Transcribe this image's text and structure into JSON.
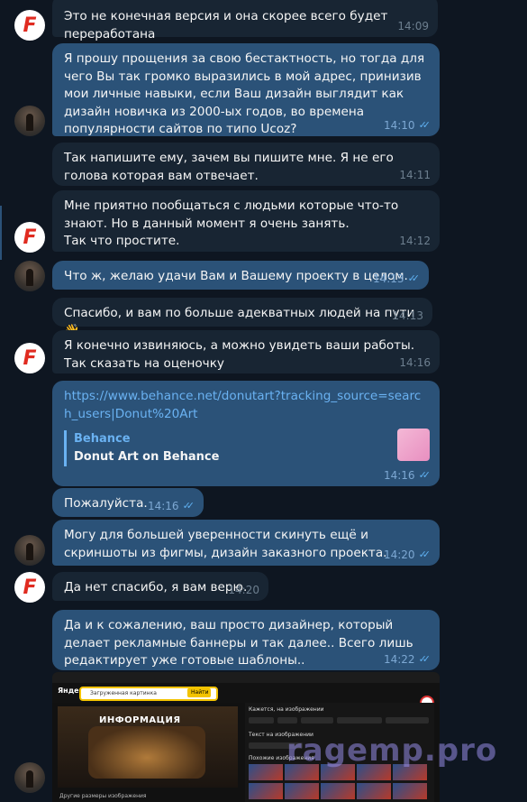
{
  "messages": [
    {
      "text": "Это не конечная версия и она скорее всего будет переработана",
      "time": "14:09",
      "read": false
    },
    {
      "text": "Я прошу прощения за свою бестактность, но тогда для чего Вы так громко выразились в мой адрес, принизив мои личные навыки, если Ваш дизайн выглядит как дизайн новичка из 2000-ых годов, во времена популярности сайтов по типо Ucoz?",
      "time": "14:10",
      "read": true
    },
    {
      "text": "Так напишите ему, зачем вы пишите мне. Я не его голова которая вам отвечает.",
      "time": "14:11",
      "read": false
    },
    {
      "text": "Мне приятно пообщаться с людьми которые что-то знают. Но в данный момент я очень занять.\nТак что простите.",
      "time": "14:12",
      "read": false
    },
    {
      "text": "Что ж, желаю удачи Вам и Вашему проекту в целом.",
      "time": "14:13",
      "read": true
    },
    {
      "text": "Спасибо, и вам по больше адекватных людей на пути",
      "emoji": "👋",
      "time": "14:13",
      "read": false
    },
    {
      "text": "Я конечно извиняюсь, а можно увидеть ваши работы. Так сказать на оценочку",
      "time": "14:16",
      "read": false
    },
    {
      "link": "https://www.behance.net/donutart?tracking_source=search_users|Donut%20Art",
      "preview_site": "Behance",
      "preview_title": "Donut Art on Behance",
      "time": "14:16",
      "read": true
    },
    {
      "text": "Пожалуйста.",
      "time": "14:16",
      "read": true
    },
    {
      "text": "Могу для большей уверенности скинуть ещё и скриншоты из фигмы, дизайн заказного проекта.",
      "time": "14:20",
      "read": true
    },
    {
      "text": "Да нет спасибо, я вам верю.",
      "time": "14:20",
      "read": false
    },
    {
      "text": "Да и к сожалению, ваш просто дизайнер, который делает рекламные баннеры и так далее.. Всего лишь редактирует уже готовые шаблоны..",
      "time": "14:22",
      "read": true
    }
  ],
  "avatars": {
    "logo_letter": "F"
  },
  "attachment": {
    "logo": "Яндекс",
    "search_text": "Загруженная картинка",
    "find_button": "Найти",
    "banner_text": "ИНФОРМАЦИЯ",
    "panel_title": "Кажется, на изображении",
    "panel_text": "Текст на изображении",
    "similar_title": "Похожие изображения",
    "more_sizes": "Другие размеры изображения"
  },
  "watermark": "ragemp.pro",
  "colors": {
    "bg": "#0e1621",
    "incoming": "#182533",
    "outgoing": "#2b5278",
    "link": "#6ab2f2",
    "read_check": "#5fb0f0"
  }
}
